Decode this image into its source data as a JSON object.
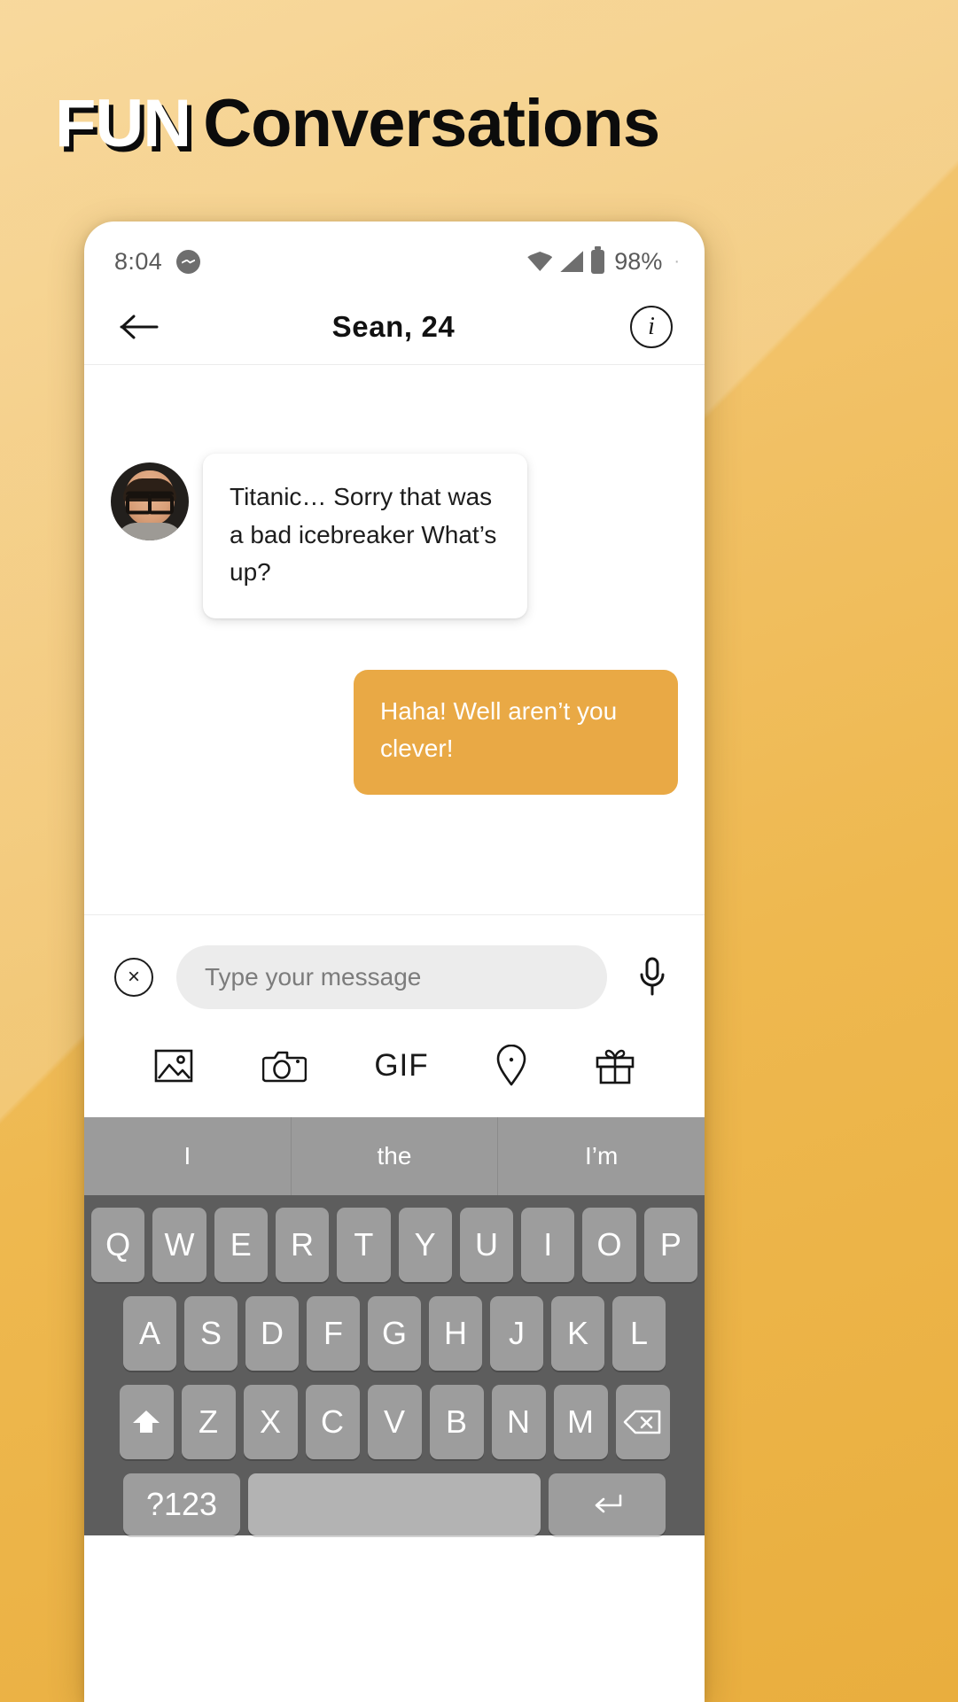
{
  "headline": {
    "accent": "FUN",
    "rest": "Conversations"
  },
  "theme": {
    "background_start": "#f6cf84",
    "background_end": "#e9ae3e",
    "accent": "#e9a945",
    "bubble_out_bg": "#e9a945",
    "bubble_in_bg": "#ffffff"
  },
  "status_bar": {
    "time": "8:04",
    "notification_icon": "messenger-icon",
    "wifi_icon": "wifi-icon",
    "signal_icon": "cellular-signal-icon",
    "battery_icon": "battery-icon",
    "battery_percent": "98%"
  },
  "chat_header": {
    "back_icon": "back-arrow-icon",
    "title": "Sean, 24",
    "info_icon": "info-icon",
    "info_label": "i"
  },
  "messages": [
    {
      "direction": "in",
      "sender": "Sean",
      "avatar": "user-avatar",
      "text": "Titanic… Sorry that was a bad icebreaker What’s up?"
    },
    {
      "direction": "out",
      "sender": "me",
      "text": "Haha! Well aren’t you clever!"
    }
  ],
  "composer": {
    "close_icon": "close-circle-icon",
    "close_label": "×",
    "input_placeholder": "Type your message",
    "input_value": "",
    "mic_icon": "microphone-icon"
  },
  "attach_bar": {
    "items": [
      {
        "name": "photo-icon",
        "label": ""
      },
      {
        "name": "camera-icon",
        "label": ""
      },
      {
        "name": "gif-icon",
        "label": "GIF"
      },
      {
        "name": "location-pin-icon",
        "label": ""
      },
      {
        "name": "gift-icon",
        "label": ""
      }
    ]
  },
  "keyboard": {
    "suggestions": [
      "I",
      "the",
      "I’m"
    ],
    "row1": [
      "Q",
      "W",
      "E",
      "R",
      "T",
      "Y",
      "U",
      "I",
      "O",
      "P"
    ],
    "row2": [
      "A",
      "S",
      "D",
      "F",
      "G",
      "H",
      "J",
      "K",
      "L"
    ],
    "row3_shift": "shift-icon",
    "row3": [
      "Z",
      "X",
      "C",
      "V",
      "B",
      "N",
      "M"
    ],
    "row3_backspace": "backspace-icon",
    "row4_numbers": "?123",
    "row4_space": "",
    "row4_enter": "enter-icon"
  }
}
